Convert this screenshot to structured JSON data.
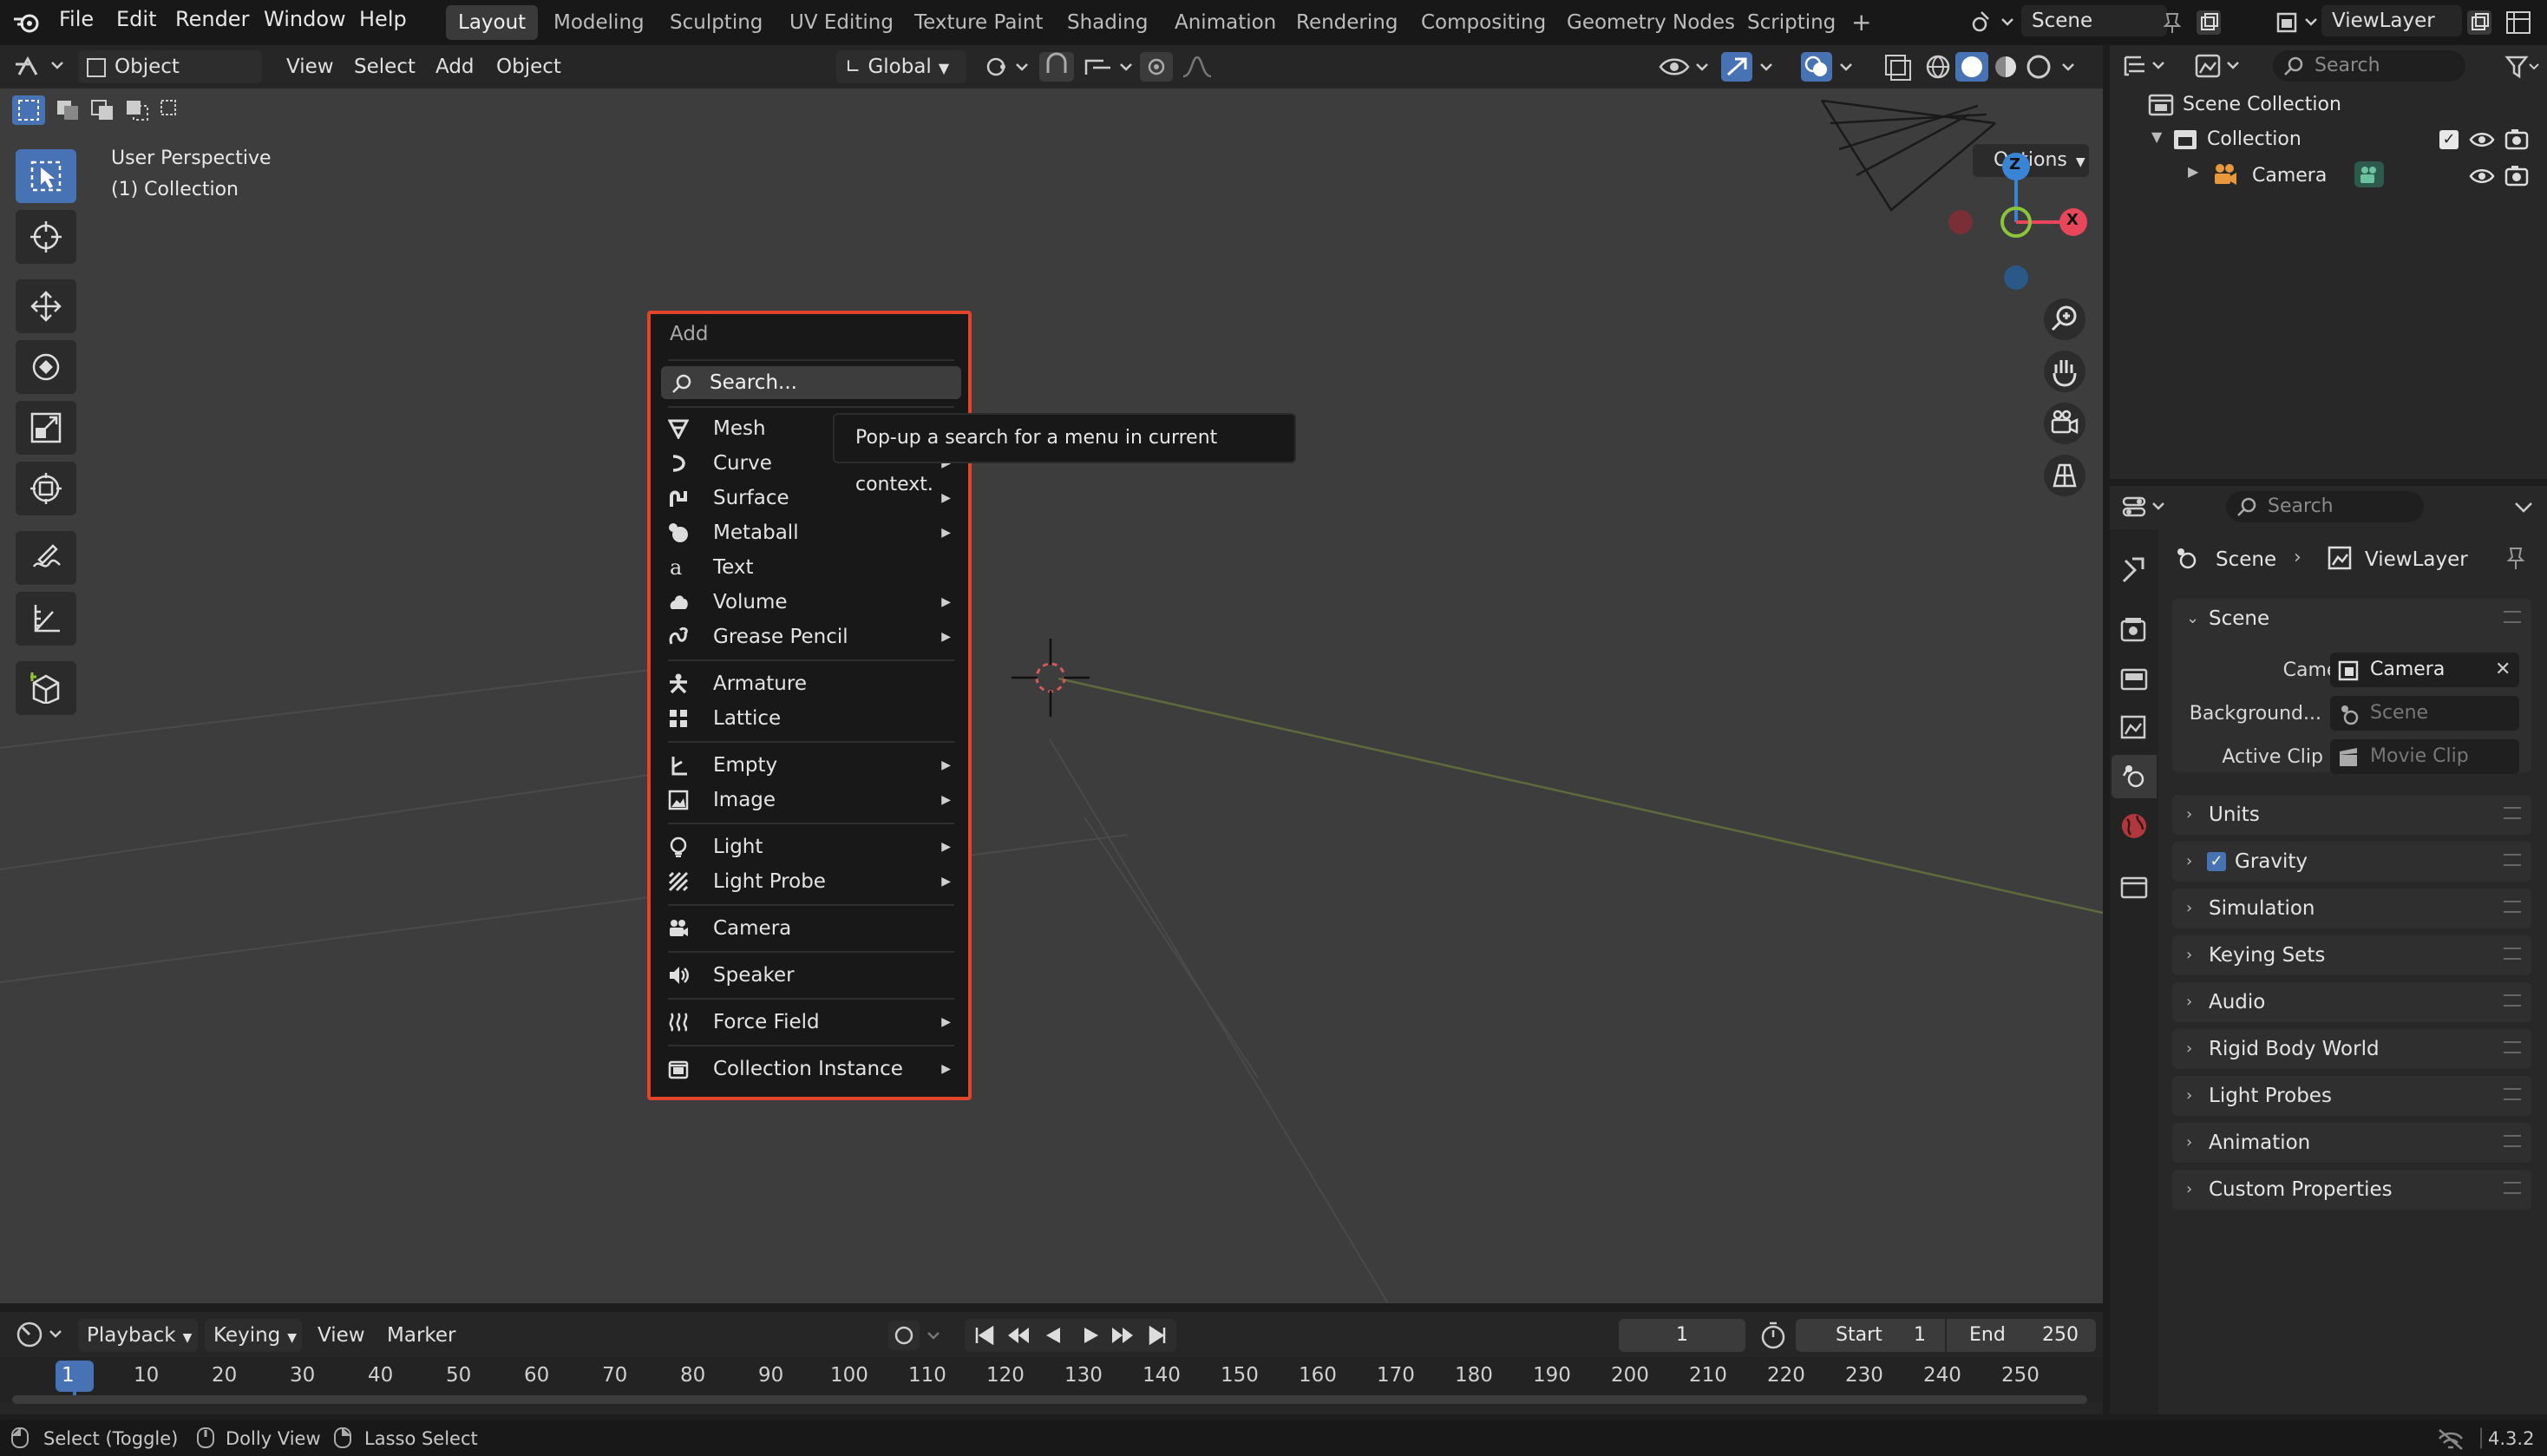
{
  "topbar": {
    "menus": [
      "File",
      "Edit",
      "Render",
      "Window",
      "Help"
    ],
    "workspaces": [
      "Layout",
      "Modeling",
      "Sculpting",
      "UV Editing",
      "Texture Paint",
      "Shading",
      "Animation",
      "Rendering",
      "Compositing",
      "Geometry Nodes",
      "Scripting"
    ],
    "add_workspace": "+",
    "scene": "Scene",
    "view_layer": "ViewLayer"
  },
  "viewport_header": {
    "mode": "Object Mode",
    "menus": [
      "View",
      "Select",
      "Add",
      "Object"
    ],
    "transform": "Global",
    "options": "Options"
  },
  "viewport": {
    "perspective": "User Perspective",
    "collection": "(1) Collection",
    "gizmo": {
      "z": "Z",
      "x": "X"
    }
  },
  "add_menu": {
    "title": "Add",
    "search": "Search...",
    "items": [
      {
        "label": "Mesh",
        "icon": "mesh-icon",
        "sub": true
      },
      {
        "label": "Curve",
        "icon": "curve-icon",
        "sub": true
      },
      {
        "label": "Surface",
        "icon": "surface-icon",
        "sub": true
      },
      {
        "label": "Metaball",
        "icon": "metaball-icon",
        "sub": true
      },
      {
        "label": "Text",
        "icon": "text-icon",
        "sub": false
      },
      {
        "label": "Volume",
        "icon": "volume-icon",
        "sub": true
      },
      {
        "label": "Grease Pencil",
        "icon": "grease-pencil-icon",
        "sub": true
      },
      {
        "label": "Armature",
        "icon": "armature-icon",
        "sub": false
      },
      {
        "label": "Lattice",
        "icon": "lattice-icon",
        "sub": false
      },
      {
        "label": "Empty",
        "icon": "empty-icon",
        "sub": true
      },
      {
        "label": "Image",
        "icon": "image-icon",
        "sub": true
      },
      {
        "label": "Light",
        "icon": "light-icon",
        "sub": true
      },
      {
        "label": "Light Probe",
        "icon": "light-probe-icon",
        "sub": true
      },
      {
        "label": "Camera",
        "icon": "camera-icon",
        "sub": false
      },
      {
        "label": "Speaker",
        "icon": "speaker-icon",
        "sub": false
      },
      {
        "label": "Force Field",
        "icon": "force-field-icon",
        "sub": true
      },
      {
        "label": "Collection Instance",
        "icon": "collection-instance-icon",
        "sub": true
      }
    ]
  },
  "tooltip": "Pop-up a search for a menu in current context.",
  "outliner": {
    "search_placeholder": "Search",
    "scene_collection": "Scene Collection",
    "collection": "Collection",
    "camera": "Camera"
  },
  "properties": {
    "search_placeholder": "Search",
    "breadcrumb_scene": "Scene",
    "breadcrumb_view_layer": "ViewLayer",
    "scene_panel": "Scene",
    "camera_label": "Camera",
    "camera_value": "Camera",
    "background_label": "Background...",
    "background_value": "Scene",
    "clip_label": "Active Clip",
    "clip_value": "Movie Clip",
    "panels": [
      "Units",
      "Gravity",
      "Simulation",
      "Keying Sets",
      "Audio",
      "Rigid Body World",
      "Light Probes",
      "Animation",
      "Custom Properties"
    ]
  },
  "timeline": {
    "menus": [
      "Playback",
      "Keying",
      "View",
      "Marker"
    ],
    "current_frame": "1",
    "start_label": "Start",
    "start_value": "1",
    "end_label": "End",
    "end_value": "250",
    "ticks": [
      "1",
      "10",
      "20",
      "30",
      "40",
      "50",
      "60",
      "70",
      "80",
      "90",
      "100",
      "110",
      "120",
      "130",
      "140",
      "150",
      "160",
      "170",
      "180",
      "190",
      "200",
      "210",
      "220",
      "230",
      "240",
      "250"
    ]
  },
  "statusbar": {
    "select": "Select (Toggle)",
    "dolly": "Dolly View",
    "lasso": "Lasso Select",
    "version": "4.3.2"
  },
  "colors": {
    "accent": "#4772b3",
    "highlight": "#e0452b",
    "x_axis": "#e8475b",
    "y_axis": "#8cc43c",
    "z_axis": "#3a84d6"
  }
}
